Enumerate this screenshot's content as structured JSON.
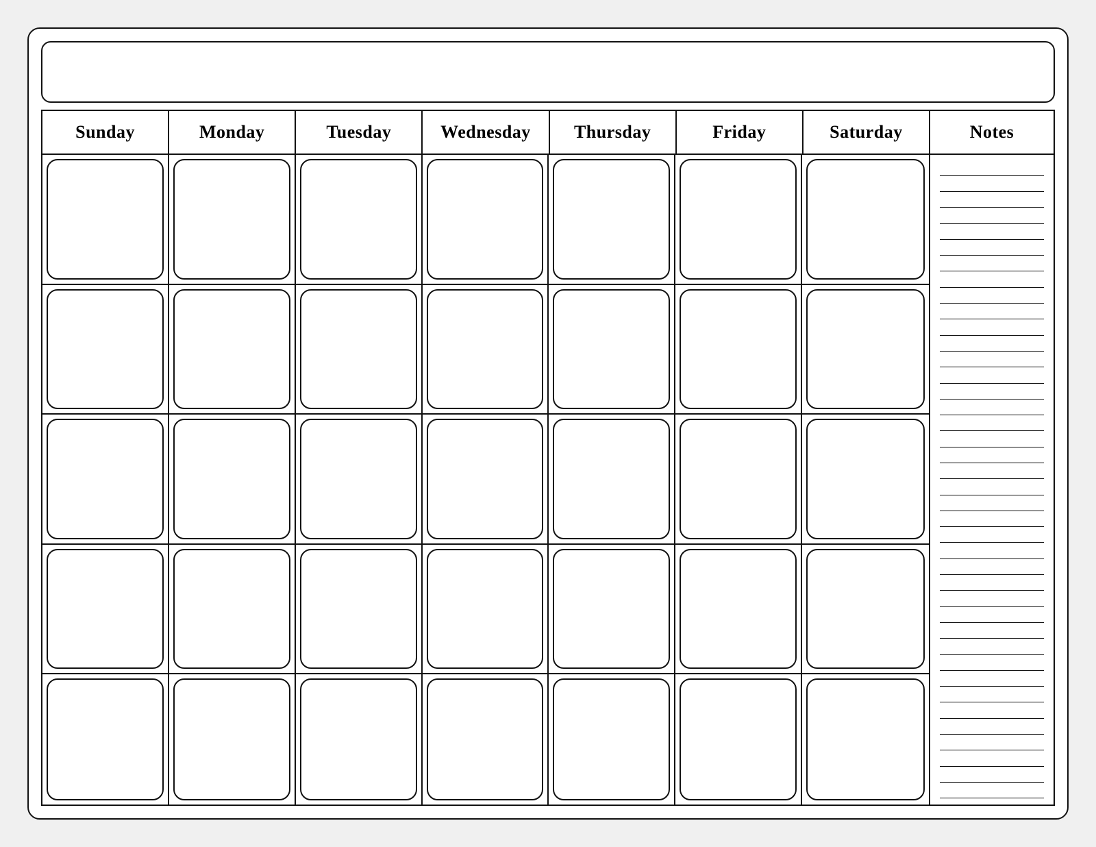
{
  "calendar": {
    "title": "",
    "days": [
      "Sunday",
      "Monday",
      "Tuesday",
      "Wednesday",
      "Thursday",
      "Friday",
      "Saturday"
    ],
    "notes_label": "Notes",
    "weeks": 5,
    "notes_lines": 40
  }
}
